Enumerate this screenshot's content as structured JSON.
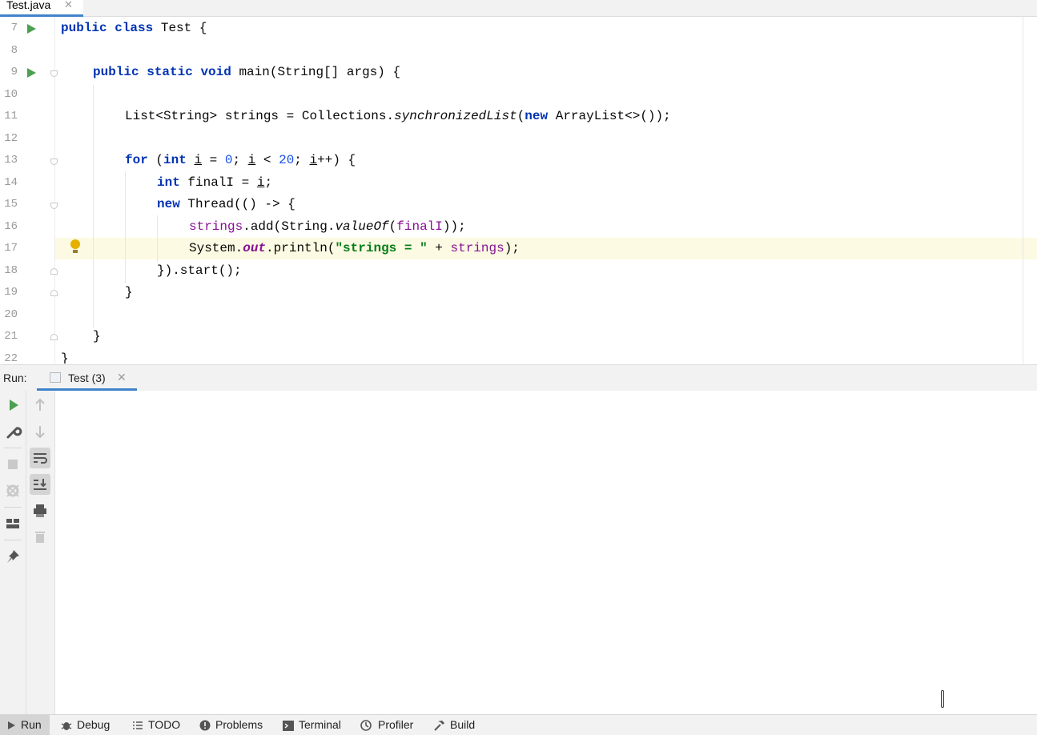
{
  "editor_tab": {
    "label": "Test.java",
    "close": "✕"
  },
  "line_numbers": [
    "7",
    "8",
    "9",
    "10",
    "11",
    "12",
    "13",
    "14",
    "15",
    "16",
    "17",
    "18",
    "19",
    "20",
    "21",
    "22"
  ],
  "code": {
    "l7": {
      "a": "public",
      "b": "class",
      "c": " Test {"
    },
    "l9": {
      "a": "public",
      "b": "static",
      "c": "void",
      "d": " main(String[] args) {"
    },
    "l11": {
      "a": "List<String> strings = Collections.",
      "b": "synchronizedList",
      "c": "(",
      "d": "new",
      "e": " ArrayList<>());"
    },
    "l13": {
      "a": "for",
      "b": " (",
      "c": "int",
      "d": " ",
      "e": "i",
      "f": " = ",
      "g": "0",
      "h": "; ",
      "i": "i",
      "j": " < ",
      "k": "20",
      "l": "; ",
      "m": "i",
      "n": "++) {"
    },
    "l14": {
      "a": "int",
      "b": " finalI = ",
      "c": "i",
      "d": ";"
    },
    "l15": {
      "a": "new",
      "b": " Thread(() -> {"
    },
    "l16": {
      "a": "strings",
      "b": ".add(String.",
      "c": "valueOf",
      "d": "(",
      "e": "finalI",
      "f": "));"
    },
    "l17": {
      "a": "System.",
      "b": "out",
      "c": ".println(",
      "d": "\"strings = \"",
      "e": " + ",
      "f": "strings",
      "g": ");"
    },
    "l18": "}).start();",
    "l19": "}",
    "l21": "}",
    "l22": "}"
  },
  "run_panel": {
    "title": "Run:",
    "tab_label": "Test (3)",
    "tab_close": "✕"
  },
  "bottom_tabs": {
    "run": "Run",
    "debug": "Debug",
    "todo": "TODO",
    "problems": "Problems",
    "terminal": "Terminal",
    "profiler": "Profiler",
    "build": "Build"
  },
  "colors": {
    "keyword": "#0033b3",
    "number": "#1750eb",
    "string": "#067d17",
    "field": "#871094",
    "run_green": "#4ba052",
    "caret_row": "#fcfae2",
    "accent": "#4083c9"
  }
}
